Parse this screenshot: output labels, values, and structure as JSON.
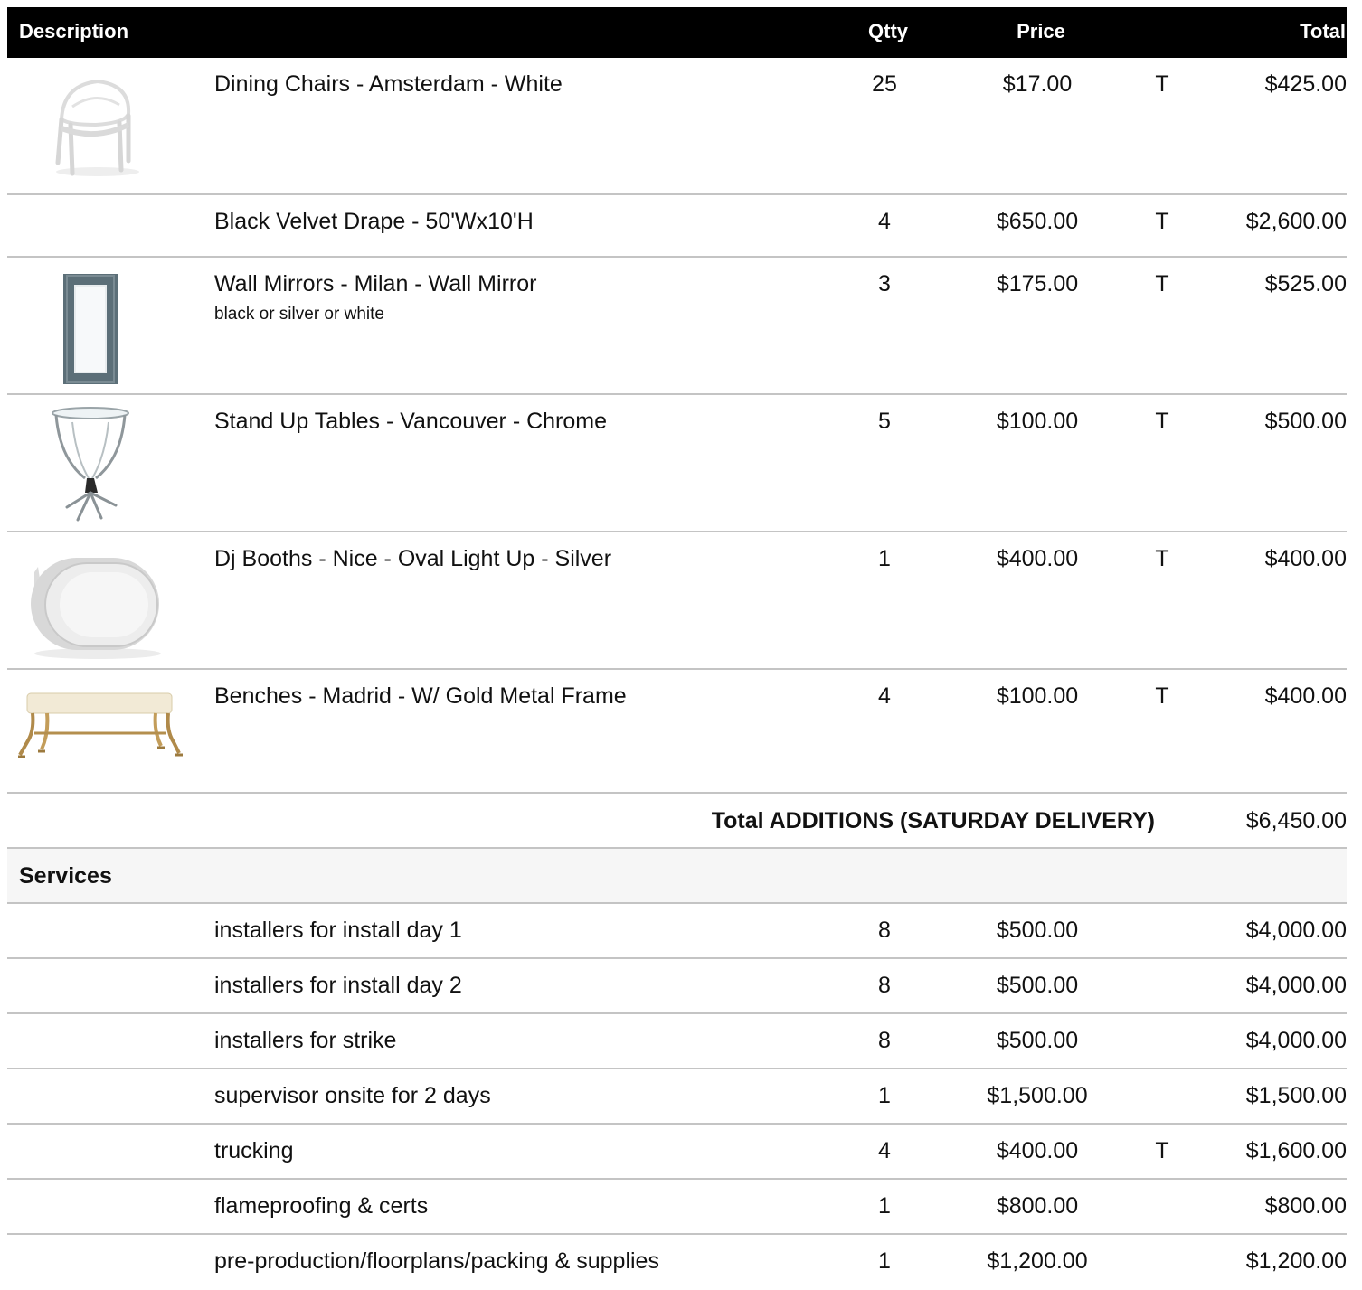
{
  "header": {
    "description": "Description",
    "qty": "Qtty",
    "price": "Price",
    "total": "Total"
  },
  "items": [
    {
      "name": "Dining Chairs - Amsterdam - White",
      "note": "",
      "qty": "25",
      "price": "$17.00",
      "tax": "T",
      "total": "$425.00",
      "image": "white-chair-photo"
    },
    {
      "name": "Black Velvet Drape - 50'Wx10'H",
      "note": "",
      "qty": "4",
      "price": "$650.00",
      "tax": "T",
      "total": "$2,600.00",
      "image": ""
    },
    {
      "name": "Wall Mirrors - Milan - Wall Mirror",
      "note": "black or silver or white",
      "qty": "3",
      "price": "$175.00",
      "tax": "T",
      "total": "$525.00",
      "image": "wall-mirror-photo"
    },
    {
      "name": "Stand Up Tables - Vancouver - Chrome",
      "note": "",
      "qty": "5",
      "price": "$100.00",
      "tax": "T",
      "total": "$500.00",
      "image": "chrome-table-photo"
    },
    {
      "name": "Dj Booths - Nice - Oval Light Up - Silver",
      "note": "",
      "qty": "1",
      "price": "$400.00",
      "tax": "T",
      "total": "$400.00",
      "image": "oval-dj-booth-photo"
    },
    {
      "name": "Benches - Madrid - W/ Gold Metal Frame",
      "note": "",
      "qty": "4",
      "price": "$100.00",
      "tax": "T",
      "total": "$400.00",
      "image": "gold-bench-photo"
    }
  ],
  "subtotal": {
    "label": "Total ADDITIONS (SATURDAY DELIVERY)",
    "value": "$6,450.00"
  },
  "services": {
    "label": "Services",
    "rows": [
      {
        "name": "installers for install day 1",
        "qty": "8",
        "price": "$500.00",
        "tax": "",
        "total": "$4,000.00"
      },
      {
        "name": "installers for install day 2",
        "qty": "8",
        "price": "$500.00",
        "tax": "",
        "total": "$4,000.00"
      },
      {
        "name": "installers for strike",
        "qty": "8",
        "price": "$500.00",
        "tax": "",
        "total": "$4,000.00"
      },
      {
        "name": "supervisor onsite for 2 days",
        "qty": "1",
        "price": "$1,500.00",
        "tax": "",
        "total": "$1,500.00"
      },
      {
        "name": "trucking",
        "qty": "4",
        "price": "$400.00",
        "tax": "T",
        "total": "$1,600.00"
      },
      {
        "name": "flameproofing & certs",
        "qty": "1",
        "price": "$800.00",
        "tax": "",
        "total": "$800.00"
      },
      {
        "name": "pre-production/floorplans/packing & supplies",
        "qty": "1",
        "price": "$1,200.00",
        "tax": "",
        "total": "$1,200.00"
      }
    ]
  },
  "colors": {
    "header_bg": "#000000",
    "header_text": "#ffffff",
    "divider": "#c4c4c4",
    "section_bg": "#f6f6f6"
  }
}
